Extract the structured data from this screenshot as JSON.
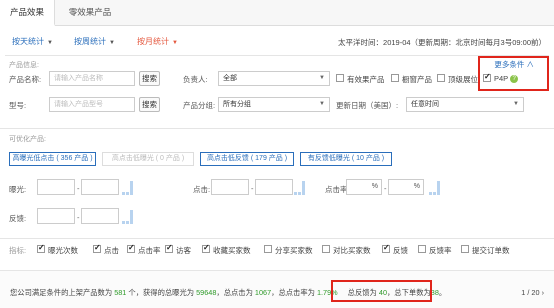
{
  "tabs": [
    {
      "label": "产品效果"
    },
    {
      "label": "零效果产品"
    }
  ],
  "toolbar": {
    "daily": "按天统计",
    "weekly": "按周统计",
    "monthly": "按月统计",
    "period_text": "太平洋时间：2019-04（更新周期：北京时间每月3号09:00前）"
  },
  "filters": {
    "section_title": "产品信息:",
    "more_label": "更多条件",
    "product_name_label": "产品名称:",
    "product_name_placeholder": "请输入产品名称",
    "search_label": "搜索",
    "owner_label": "负责人:",
    "owner_value": "全部",
    "model_label": "型号:",
    "model_placeholder": "请输入产品型号",
    "search2_label": "搜索",
    "group_label": "产品分组:",
    "group_value": "所有分组",
    "update_label": "更新日期（美国）:",
    "update_value": "任意时间",
    "checks": [
      {
        "label": "有效果产品",
        "checked": false
      },
      {
        "label": "橱窗产品",
        "checked": false
      },
      {
        "label": "顶级展位",
        "checked": false
      },
      {
        "label": "P4P",
        "checked": true
      }
    ]
  },
  "optimize": {
    "section_title": "可优化产品:",
    "pills": [
      {
        "label": "高曝光低点击 ( 356 产品 )",
        "disabled": false
      },
      {
        "label": "高点击低曝光 ( 0 产品 )",
        "disabled": true
      },
      {
        "label": "高点击低反馈 ( 179 产品 )",
        "disabled": false
      },
      {
        "label": "有反馈低曝光 ( 10 产品 )",
        "disabled": false
      }
    ],
    "exposure_label": "曝光:",
    "click_label": "点击:",
    "ctr_label": "点击率:",
    "feedback_label": "反馈:",
    "pct": "%",
    "dash": "-"
  },
  "metrics": {
    "label": "指标:",
    "items": [
      {
        "label": "曝光次数",
        "checked": true
      },
      {
        "label": "点击",
        "checked": true
      },
      {
        "label": "点击率",
        "checked": true
      },
      {
        "label": "访客",
        "checked": true
      },
      {
        "label": "收藏买家数",
        "checked": true
      },
      {
        "label": "分享买家数",
        "checked": false
      },
      {
        "label": "对比买家数",
        "checked": false
      },
      {
        "label": "反馈",
        "checked": true
      },
      {
        "label": "反馈率",
        "checked": false
      },
      {
        "label": "提交订单数",
        "checked": false
      }
    ]
  },
  "summary": {
    "p1": "您公司满足条件的上架产品数为 ",
    "count": "581",
    "p2": " 个，获得的总曝光为 ",
    "exposure": "59648",
    "p3": "，总点击为 ",
    "clicks": "1067",
    "p4": "，总点击率为 ",
    "ctr": "1.79%",
    "p5": "总反馈为 ",
    "feedback": "40",
    "p6": "，总下单数为",
    "orders": "38",
    "p7": "。",
    "page": "1 / 20"
  },
  "colors": {
    "accent": "#2a6ebb",
    "highlight": "#e0251b",
    "green": "#2e9a29"
  }
}
